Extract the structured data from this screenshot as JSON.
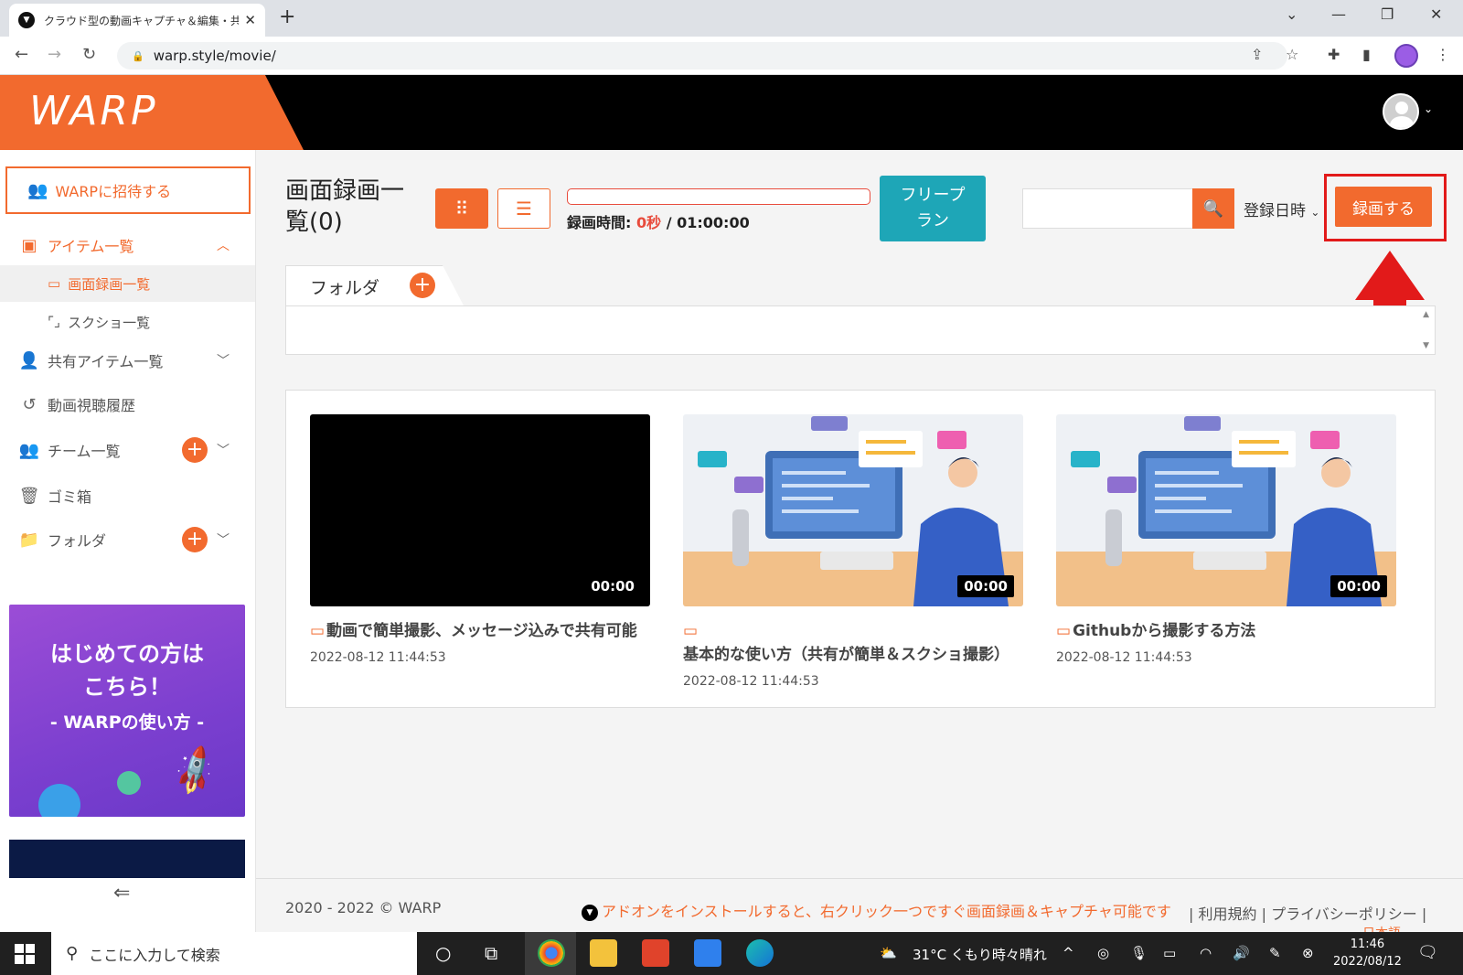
{
  "browser": {
    "tab_title": "クラウド型の動画キャプチャ＆編集・共",
    "url": "warp.style/movie/"
  },
  "app": {
    "logo": "WARP"
  },
  "sidebar": {
    "invite": "WARPに招待する",
    "items_list": "アイテム一覧",
    "sub_recordings": "画面録画一覧",
    "sub_screenshots": "スクショ一覧",
    "shared_items": "共有アイテム一覧",
    "history": "動画視聴履歴",
    "teams": "チーム一覧",
    "trash": "ゴミ箱",
    "folders": "フォルダ",
    "banner_line1": "はじめての方は",
    "banner_line2": "こちら！",
    "banner_line3": "- WARPの使い方 -"
  },
  "main": {
    "title": "画面録画一覧(0)",
    "rec_time_label": "録画時間:",
    "rec_time_used": "0秒",
    "rec_time_total": "/ 01:00:00",
    "rec_time_progress": 0,
    "free_plan": "フリープラン",
    "search_placeholder": "",
    "sort_label": "登録日時",
    "record_button": "録画する",
    "folder_tab": "フォルダ"
  },
  "cards": [
    {
      "title": "動画で簡単撮影、メッセージ込みで共有可能",
      "date": "2022-08-12 11:44:53",
      "duration": "00:00"
    },
    {
      "title": "基本的な使い方（共有が簡単＆スクショ撮影）",
      "date": "2022-08-12 11:44:53",
      "duration": "00:00"
    },
    {
      "title": "Githubから撮影する方法",
      "date": "2022-08-12 11:44:53",
      "duration": "00:00"
    }
  ],
  "footer": {
    "copyright": "2020 - 2022 © WARP",
    "addon": "アドオンをインストールすると、右クリック一つですぐ画面録画＆キャプチャ可能です",
    "terms": "利用規約",
    "privacy": "プライバシーポリシー",
    "language": "日本語"
  },
  "taskbar": {
    "search_placeholder": "ここに入力して検索",
    "weather": "31°C くもり時々晴れ",
    "time": "11:46",
    "date": "2022/08/12"
  },
  "colors": {
    "accent": "#f26a2e",
    "teal": "#1ea6b7",
    "highlight": "#e21a1a"
  }
}
